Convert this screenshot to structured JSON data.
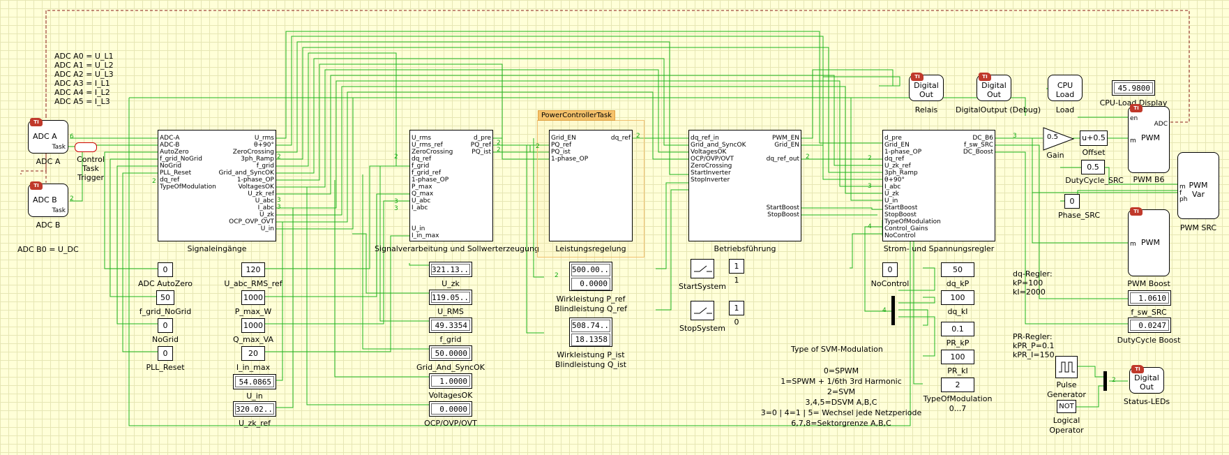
{
  "adc_notes": [
    "ADC A0 = U_L1",
    "ADC A1 = U_L2",
    "ADC A2 = U_L3",
    "ADC A3 = I_L1",
    "ADC A4 = I_L2",
    "ADC A5 = I_L3"
  ],
  "adc_b_note": "ADC B0 = U_DC",
  "adc_a": {
    "title": "ADC A",
    "port": "Task",
    "label": "ADC A"
  },
  "adc_b": {
    "title": "ADC B",
    "port": "Task",
    "label": "ADC B"
  },
  "control_task": "Control Task Trigger",
  "signaleingaenge": {
    "label": "Signaleingänge",
    "inputs": [
      "ADC-A",
      "ADC-B",
      "AutoZero",
      "f_grid_NoGrid",
      "NoGrid",
      "PLL_Reset",
      "dq_ref",
      "TypeOfModulation"
    ],
    "outputs": [
      "U_rms",
      "θ+90°",
      "ZeroCrossing",
      "3ph_Ramp",
      "f_grid",
      "Grid_and_SyncOK",
      "1-phase_OP",
      "VoltagesOK",
      "U_zk_ref",
      "U_abc",
      "I_abc",
      "U_zk",
      "OCP_OVP_OVT",
      "U_in"
    ]
  },
  "signalverarbeitung": {
    "label": "Signalverarbeitung und Sollwerterzeugung",
    "inputs": [
      "U_rms",
      "U_rms_ref",
      "ZeroCrossing",
      "dq_ref",
      "f_grid",
      "f_grid_ref",
      "1-phase_OP",
      "P_max",
      "Q_max",
      "U_abc",
      "I_abc",
      "U_in",
      "I_in_max"
    ],
    "outputs": [
      "d_pre",
      "PQ_ref",
      "PQ_ist"
    ]
  },
  "powercontroller_task": "PowerControllerTask",
  "leistungsregelung": {
    "label": "Leistungsregelung",
    "inputs": [
      "Grid_EN",
      "PQ_ref",
      "PQ_ist",
      "1-phase_OP"
    ],
    "outputs": [
      "dq_ref"
    ]
  },
  "betriebsfuehrung": {
    "label": "Betriebsführung",
    "inputs": [
      "dq_ref_in",
      "Grid_and_SyncOK",
      "VoltagesOK",
      "OCP/OVP/OVT",
      "ZeroCrossing",
      "StartInverter",
      "StopInverter"
    ],
    "outputs": [
      "PWM_EN",
      "Grid_EN",
      "dq_ref_out",
      "StartBoost",
      "StopBoost"
    ]
  },
  "stromregler": {
    "label": "Strom- und Spannungsregler",
    "inputs": [
      "d_pre",
      "Grid_EN",
      "1-phase_OP",
      "dq_ref",
      "U_zk_ref",
      "3ph_Ramp",
      "θ+90°",
      "I_abc",
      "U_zk",
      "U_in",
      "StartBoost",
      "StopBoost",
      "TypeOfModulation",
      "Control_Gains",
      "NoControl"
    ],
    "outputs": [
      "DC_B6",
      "f_sw_SRC",
      "DC_Boost"
    ]
  },
  "constants_left": [
    {
      "value": "0",
      "label": "ADC AutoZero"
    },
    {
      "value": "50",
      "label": "f_grid_NoGrid"
    },
    {
      "value": "0",
      "label": "NoGrid"
    },
    {
      "value": "0",
      "label": "PLL_Reset"
    }
  ],
  "constants_mid": [
    {
      "value": "120",
      "label": "U_abc_RMS_ref"
    },
    {
      "value": "1000",
      "label": "P_max_W"
    },
    {
      "value": "1000",
      "label": "Q_max_VA"
    },
    {
      "value": "20",
      "label": "I_in_max"
    }
  ],
  "display_u_in": {
    "value": "54.0865",
    "label": "U_in"
  },
  "display_u_zk_ref": {
    "value": "320.02...",
    "label": "U_zk_ref"
  },
  "displays_mid": [
    {
      "value": "321.13...",
      "label": "U_zk"
    },
    {
      "value": "119.05...",
      "label": "U_RMS"
    },
    {
      "value": "49.3354",
      "label": "f_grid"
    },
    {
      "value": "50.0000",
      "label": "Grid_And_SyncOK"
    },
    {
      "value": "1.0000",
      "label": "VoltagesOK"
    },
    {
      "value": "0.0000",
      "label": "OCP/OVP/OVT"
    }
  ],
  "pref_display": {
    "values": [
      "500.00...",
      "0.0000"
    ],
    "label1": "Wirkleistung P_ref",
    "label2": "Blindleistung Q_ref"
  },
  "pist_display": {
    "values": [
      "508.74...",
      "18.1358"
    ],
    "label1": "Wirkleistung P_ist",
    "label2": "Blindleistung Q_ist"
  },
  "start_system": {
    "label": "StartSystem",
    "const": "1",
    "const_label": "1"
  },
  "stop_system": {
    "label": "StopSystem",
    "const": "1",
    "const_label": "0"
  },
  "nocontrol": {
    "value": "0",
    "label": "NoControl"
  },
  "gains": [
    {
      "value": "50",
      "label": "dq_kP"
    },
    {
      "value": "100",
      "label": "dq_kI"
    },
    {
      "value": "0.1",
      "label": "PR_kP"
    },
    {
      "value": "100",
      "label": "PR_kI"
    },
    {
      "value": "2",
      "label": "TypeOfModulation"
    }
  ],
  "type_of_modulation_range": "0...7",
  "dq_notes": [
    "dq-Regler:",
    "kP=100",
    "kI=2000"
  ],
  "pr_notes": [
    "PR-Regler:",
    "kPR_P=0.1",
    "kPR_I=150"
  ],
  "svm_title": "Type of SVM-Modulation",
  "svm_lines": [
    "0=SPWM",
    "1=SPWM + 1/6th 3rd Harmonic",
    "2=SVM",
    "3,4,5=DSVM A,B,C",
    "3=0 | 4=1 | 5= Wechsel jede Netzperiode",
    "6,7,8=Sektorgrenze A,B,C"
  ],
  "relais": {
    "line1": "Digital",
    "line2": "Out",
    "label": "Relais"
  },
  "digital_debug": {
    "line1": "Digital",
    "line2": "Out",
    "label": "DigitalOutput (Debug)"
  },
  "cpu_load": {
    "line1": "CPU",
    "line2": "Load",
    "label": "Load"
  },
  "cpu_display": {
    "value": "45.9800",
    "label": "CPU-Load Display"
  },
  "gain": {
    "value": "0.5",
    "label": "Gain"
  },
  "offset": {
    "expr": "u+0.5",
    "label": "Offset"
  },
  "dutycycle_src": {
    "value": "0.5",
    "label": "DutyCycle_SRC"
  },
  "phase_src": {
    "value": "0",
    "label": "Phase_SRC"
  },
  "pwm_b6": {
    "ports_left": [
      "en",
      "m"
    ],
    "port_right": "ADC",
    "title": "PWM",
    "label": "PWM B6"
  },
  "pwm_src": {
    "ports": [
      "m",
      "f",
      "ph"
    ],
    "title1": "PWM",
    "title2": "Var",
    "label": "PWM SRC"
  },
  "pwm_boost": {
    "port": "m",
    "title": "PWM",
    "label": "PWM Boost"
  },
  "f_sw_src": {
    "value": "1.0610",
    "label": "f_sw_SRC"
  },
  "dutycycle_boost": {
    "value": "0.0247",
    "label": "DutyCycle Boost"
  },
  "pulse_gen": {
    "label1": "Pulse",
    "label2": "Generator"
  },
  "logical_op": {
    "value": "NOT",
    "label1": "Logical",
    "label2": "Operator"
  },
  "status_leds": {
    "line1": "Digital",
    "line2": "Out",
    "label": "Status-LEDs"
  },
  "wire_counts": [
    "6",
    "2",
    "2",
    "2",
    "2",
    "2",
    "2",
    "2",
    "2",
    "3",
    "3",
    "3",
    "3",
    "4",
    "3",
    "3",
    "2",
    "2",
    "2",
    "4",
    "2"
  ],
  "colors": {
    "wire": "#1eb41e",
    "dashed": "#8b1a1a",
    "ti_badge": "#c0392b",
    "highlight": "#f5c26b",
    "background": "#ffffd8"
  }
}
